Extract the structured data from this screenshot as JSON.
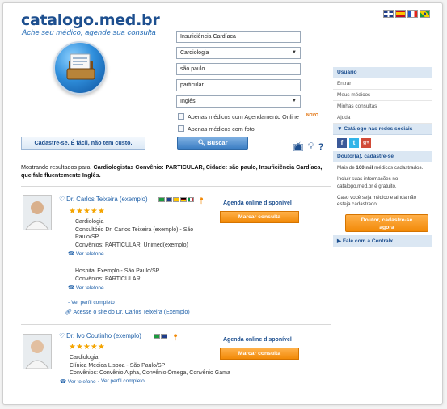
{
  "header": {
    "logo": "catalogo.med.br",
    "tagline": "Ache seu médico, agende sua consulta",
    "languages": [
      "English",
      "Español",
      "Français",
      "Português"
    ],
    "flag_colors": [
      "#1f3d8a",
      "#c9a000",
      "#1f55c6",
      "#1c9a3e"
    ]
  },
  "search": {
    "specialty_input": "Insuficiência Cardíaca",
    "specialty_select": "Cardiologia",
    "city_input": "são paulo",
    "insurance_input": "particular",
    "language_select": "Inglês",
    "opt_online_booking": "Apenas médicos com Agendamento Online",
    "opt_new_badge": "NOVO",
    "opt_with_photo": "Apenas médicos com foto",
    "search_button": "Buscar",
    "register_button": "Cadastre-se. É fácil, não tem custo."
  },
  "results": {
    "prefix": "Mostrando resultados para: ",
    "query": "Cardiologistas Convênio: PARTICULAR, Cidade: são paulo, Insuficiência Cardíaca, que fale fluentemente Inglês."
  },
  "doctors": [
    {
      "name": "Dr. Carlos Teixeira (exemplo)",
      "rating": "★★★★★",
      "specialty": "Cardiologia",
      "office1": "Consultório Dr. Carlos Teixeira (exemplo) - São Paulo/SP",
      "insurance1": "Convênios: PARTICULAR, Unimed(exemplo)",
      "phone1": "Ver telefone",
      "office2": "Hospital Exemplo - São Paulo/SP",
      "insurance2": "Convênios: PARTICULAR",
      "phone2": "Ver telefone",
      "profile_link": "- Ver perfil completo",
      "site_link": "Acesse o site do Dr. Carlos Teixeira (Exemplo)",
      "agenda": "Agenda online disponível",
      "book_button": "Marcar consulta"
    },
    {
      "name": "Dr. Ivo Coutinho (exemplo)",
      "rating": "★★★★★",
      "specialty": "Cardiologia",
      "office1": "Clínica Medica Lisboa - São Paulo/SP",
      "insurance1": "Convênios: Convênio Alpha, Convênio Ômega, Convênio Gama",
      "phone1": "Ver telefone",
      "profile_link": "- Ver perfil completo",
      "agenda": "Agenda online disponível",
      "book_button": "Marcar consulta"
    }
  ],
  "sidebar": {
    "user_header": "Usuário",
    "items": [
      "Entrar",
      "Meus médicos",
      "Minhas consultas",
      "Ajuda"
    ],
    "social_header": "▼ Catálogo nas redes sociais",
    "doctor_header": "Doutor(a), cadastre-se",
    "doctor_text1_pre": "Mais de ",
    "doctor_text1_bold": "160 mil",
    "doctor_text1_post": " médicos cadastrados.",
    "doctor_text2": "Incluir suas informações no catalogo.med.br é gratuito.",
    "doctor_text3": "Caso você seja médico e ainda não esteja cadastrado:",
    "doctor_button_line1": "Doutor, cadastre-se",
    "doctor_button_line2": "agora",
    "contact_header": "▶ Fale com a Centralx"
  }
}
